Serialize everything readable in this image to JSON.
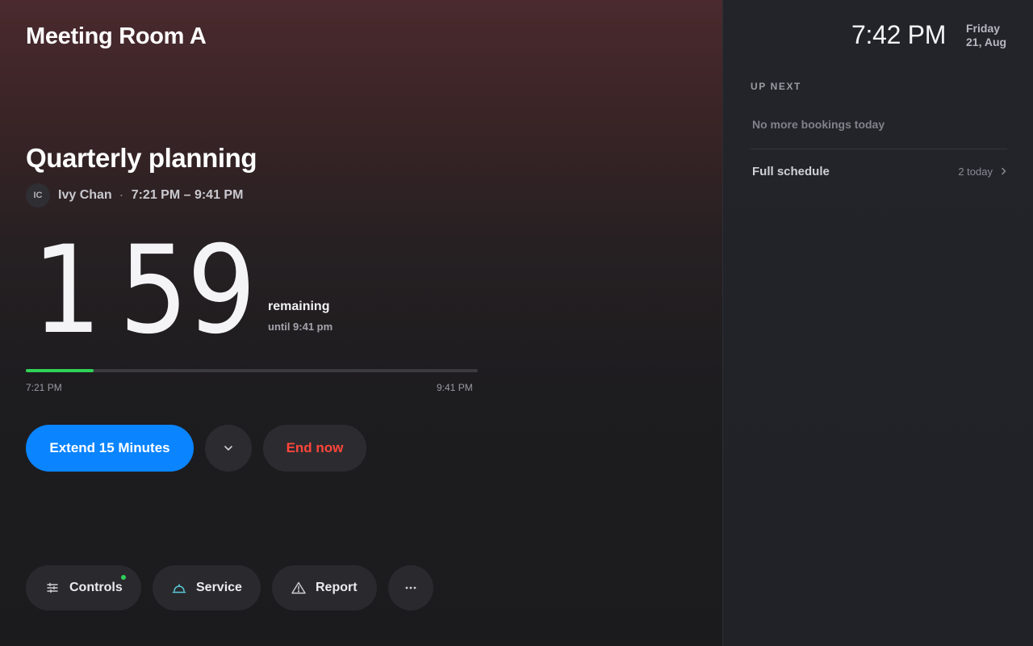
{
  "room": {
    "name": "Meeting Room A"
  },
  "meeting": {
    "title": "Quarterly planning",
    "organizer_initials": "IC",
    "organizer_name": "Ivy Chan",
    "separator": "·",
    "time_range": "7:21 PM – 9:41 PM"
  },
  "countdown": {
    "hours": "1",
    "minutes": "59",
    "label": "remaining",
    "until": "until 9:41 pm"
  },
  "progress": {
    "fraction": 0.15,
    "start_label": "7:21 PM",
    "end_label": "9:41 PM",
    "color": "#30d158"
  },
  "actions": {
    "extend_label": "Extend 15 Minutes",
    "more_icon": "chevron-down-icon",
    "end_label": "End now"
  },
  "bottom_bar": {
    "controls_label": "Controls",
    "controls_icon": "sliders-icon",
    "controls_status_color": "#30d158",
    "service_label": "Service",
    "service_icon": "service-bell-icon",
    "report_label": "Report",
    "report_icon": "warning-triangle-icon",
    "more_icon": "ellipsis-icon"
  },
  "sidebar": {
    "time": "7:42 PM",
    "day": "Friday",
    "date": "21, Aug",
    "up_next_heading": "UP NEXT",
    "empty_message": "No more bookings today",
    "full_schedule_label": "Full schedule",
    "full_schedule_count": "2 today"
  },
  "colors": {
    "accent_blue": "#0a84ff",
    "danger_red": "#ff453a",
    "success_green": "#30d158"
  }
}
